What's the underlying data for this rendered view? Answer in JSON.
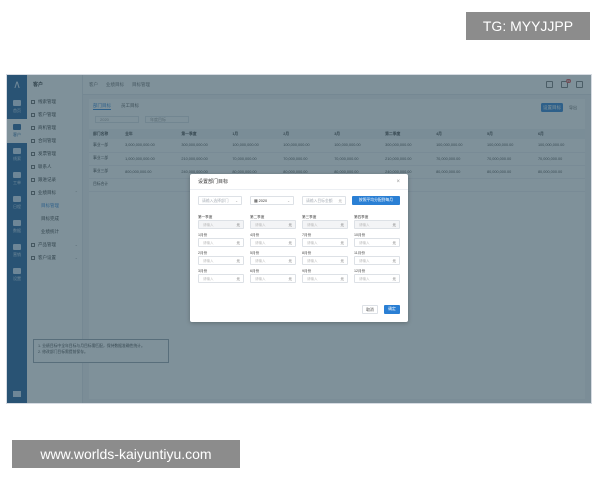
{
  "watermark_top": "TG: MYYJJPP",
  "watermark_bottom": "www.worlds-kaiyuntiyu.com",
  "rail": {
    "items": [
      {
        "label": "首页",
        "icon": "home-icon"
      },
      {
        "label": "客户",
        "icon": "users-icon"
      },
      {
        "label": "线索",
        "icon": "leads-icon"
      },
      {
        "label": "工单",
        "icon": "ticket-icon"
      },
      {
        "label": "日程",
        "icon": "calendar-icon"
      },
      {
        "label": "数据",
        "icon": "chart-icon"
      },
      {
        "label": "营销",
        "icon": "megaphone-icon"
      },
      {
        "label": "设置",
        "icon": "gear-icon"
      }
    ],
    "active_index": 1
  },
  "sidebar": {
    "title": "客户",
    "items": [
      {
        "label": "线索管理"
      },
      {
        "label": "客户管理"
      },
      {
        "label": "商机管理"
      },
      {
        "label": "合同管理"
      },
      {
        "label": "发票管理"
      },
      {
        "label": "联系人"
      },
      {
        "label": "跟进记录"
      },
      {
        "label": "业绩目标",
        "expanded": true
      }
    ],
    "subitems": [
      {
        "label": "目标管理",
        "active": true
      },
      {
        "label": "目标完成"
      },
      {
        "label": "业绩统计"
      }
    ],
    "tail_items": [
      {
        "label": "产品管理"
      },
      {
        "label": "客户设置"
      }
    ]
  },
  "topbar": {
    "breadcrumbs": [
      "客户",
      "业绩目标",
      "目标管理"
    ],
    "badge": "99"
  },
  "content": {
    "tabs": [
      "部门目标",
      "员工目标"
    ],
    "active_tab": 0,
    "set_button": "设置目标",
    "export_label": "导出",
    "filters": [
      "2020",
      "年度目标"
    ],
    "columns": [
      "部门名称",
      "全年",
      "第一季度",
      "1月",
      "2月",
      "3月",
      "第二季度",
      "4月",
      "5月",
      "6月"
    ],
    "rows": [
      [
        "事业一部",
        "3,000,000,000.00",
        "300,000,000.00",
        "100,000,000.00",
        "100,000,000.00",
        "100,000,000.00",
        "300,000,000.00",
        "100,000,000.00",
        "100,000,000.00",
        "100,000,000.00"
      ],
      [
        "事业二部",
        "1,000,000,000.00",
        "210,000,000.00",
        "70,000,000.00",
        "70,000,000.00",
        "70,000,000.00",
        "210,000,000.00",
        "70,000,000.00",
        "70,000,000.00",
        "70,000,000.00"
      ],
      [
        "事业三部",
        "800,000,000.00",
        "240,000,000.00",
        "80,000,000.00",
        "80,000,000.00",
        "80,000,000.00",
        "240,000,000.00",
        "80,000,000.00",
        "80,000,000.00",
        "80,000,000.00"
      ],
      [
        "目标合计",
        "",
        "",
        "",
        "",
        "",
        "",
        "",
        "",
        ""
      ]
    ],
    "notes": [
      "1. 业绩目标中全年目标与月目标需匹配，保持数据准确性统计。",
      "2. 修改部门目标需提前保存。"
    ]
  },
  "modal": {
    "title": "设置部门目标",
    "dept_placeholder": "请输入选择部门",
    "year_value": "2020",
    "target_placeholder": "请输入目标金额",
    "generate_button": "按照平均分配到每月",
    "input_placeholder": "请输入",
    "unit": "元",
    "cells": [
      {
        "label": "第一季度",
        "disabled": true
      },
      {
        "label": "第二季度",
        "disabled": true
      },
      {
        "label": "第三季度",
        "disabled": true
      },
      {
        "label": "第四季度",
        "disabled": true
      },
      {
        "label": "1月份"
      },
      {
        "label": "4月份"
      },
      {
        "label": "7月份"
      },
      {
        "label": "10月份"
      },
      {
        "label": "2月份"
      },
      {
        "label": "5月份"
      },
      {
        "label": "8月份"
      },
      {
        "label": "11月份"
      },
      {
        "label": "3月份"
      },
      {
        "label": "6月份"
      },
      {
        "label": "9月份"
      },
      {
        "label": "12月份"
      }
    ],
    "cancel_button": "取消",
    "ok_button": "确定"
  }
}
